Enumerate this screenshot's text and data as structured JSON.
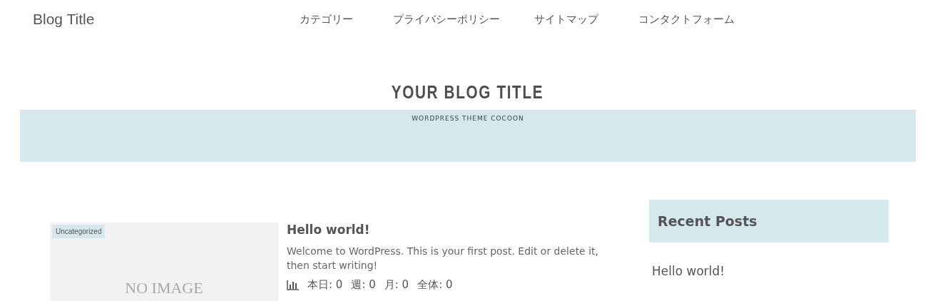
{
  "site_title": "Blog Title",
  "nav": [
    {
      "label": "カテゴリー"
    },
    {
      "label": "プライバシーポリシー"
    },
    {
      "label": "サイトマップ"
    },
    {
      "label": "コンタクトフォーム"
    }
  ],
  "header": {
    "logo": "YOUR BLOG TITLE",
    "tagline": "WORDPRESS THEME COCOON"
  },
  "posts": [
    {
      "category": "Uncategorized",
      "thumbnail": "NO IMAGE",
      "title": "Hello world!",
      "excerpt": "Welcome to WordPress. This is your first post. Edit or delete it, then start writing!",
      "views": [
        "本日: 0",
        "週: 0",
        "月: 0",
        "全体: 0"
      ]
    }
  ],
  "sidebar": {
    "heading": "Recent Posts",
    "items": [
      "Hello world!"
    ]
  }
}
